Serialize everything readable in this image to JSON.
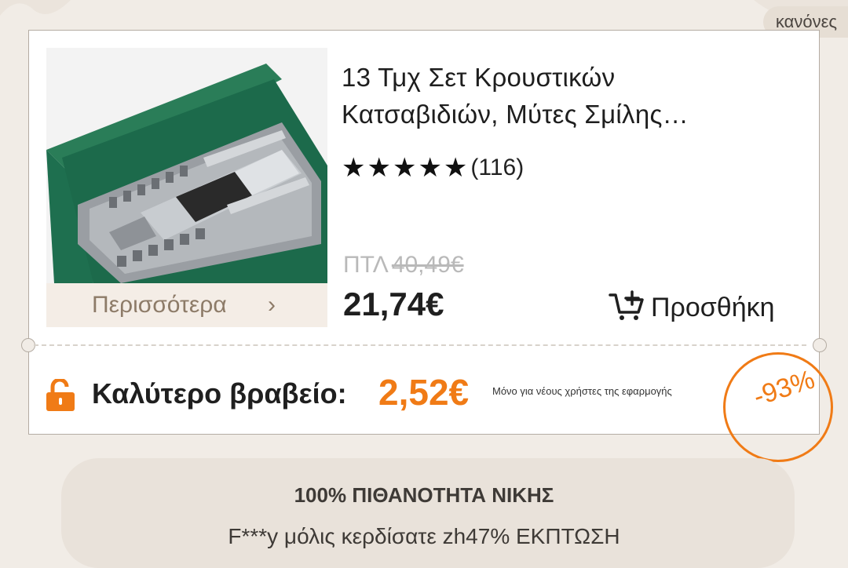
{
  "header": {
    "rules_label": "κανόνες"
  },
  "product": {
    "title_line1": "13 Τμχ Σετ Κρουστικών",
    "title_line2": "Κατσαβιδιών, Μύτες Σμίλης…",
    "stars": "★★★★★",
    "rating_count": "(116)",
    "old_price_prefix": "ΠΤΛ",
    "old_price": "40,49€",
    "price": "21,74€",
    "more_label": "Περισσότερα",
    "more_chevron": "›",
    "add_label": "Προσθήκη",
    "add_icon": "add-to-cart-icon",
    "image_icon": "screwdriver-set-image"
  },
  "prize": {
    "label": "Καλύτερο βραβείο:",
    "value": "2,52€",
    "note": "Μόνο για νέους χρήστες της εφαρμογής",
    "discount": "-93%",
    "lock_icon": "unlocked-padlock-icon"
  },
  "bottom": {
    "title": "100% ΠΙΘΑΝΟΤΗΤΑ ΝΙΚΗΣ",
    "subtitle": "F***y μόλις κερδίσατε zh47% ΕΚΠΤΩΣΗ"
  },
  "colors": {
    "accent": "#f07b16",
    "background": "#f1ece6",
    "box_green": "#1e6f4f"
  }
}
